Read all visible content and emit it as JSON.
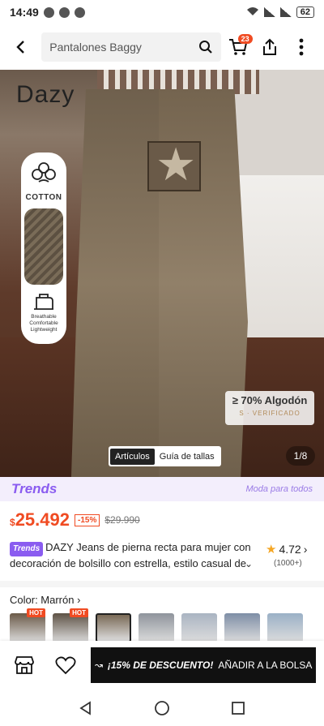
{
  "status": {
    "time": "14:49",
    "battery": "62"
  },
  "search": {
    "placeholder": "Pantalones Baggy"
  },
  "cart": {
    "count": "23"
  },
  "hero": {
    "brand": "Dazy",
    "feature_cotton": "COTTON",
    "feature_text": "Breathable Comfortable Lightweight",
    "composition_main": "≥ 70% Algodón",
    "composition_sub": "S · VERIFICADO",
    "tabs": [
      "Artículos",
      "Guía de tallas"
    ],
    "counter": "1/8"
  },
  "trends": {
    "logo": "Trends",
    "right": "Moda para todos"
  },
  "price": {
    "currency": "$",
    "current": "25.492",
    "discount": "-15%",
    "original": "$29.990"
  },
  "product": {
    "trends_tag": "Trends",
    "title": "DAZY Jeans de pierna recta para mujer con decoración de bolsillo con estrella, estilo casual de",
    "rating": "4.72",
    "rating_count": "(1000+)"
  },
  "colors": {
    "label": "Color: Marrón",
    "hot_label": "HOT",
    "thumbs": [
      {
        "color": "#6b5a48",
        "hot": true
      },
      {
        "color": "#5e5245",
        "hot": true
      },
      {
        "color": "#7a6a56",
        "hot": false
      },
      {
        "color": "#8f949c",
        "hot": false
      },
      {
        "color": "#aab4c2",
        "hot": false
      },
      {
        "color": "#7e8ea6",
        "hot": false
      },
      {
        "color": "#9ab0c6",
        "hot": false
      }
    ]
  },
  "bottom": {
    "promo": "¡15% DE DESCUENTO!",
    "add_label": "AÑADIR A LA BOLSA"
  }
}
